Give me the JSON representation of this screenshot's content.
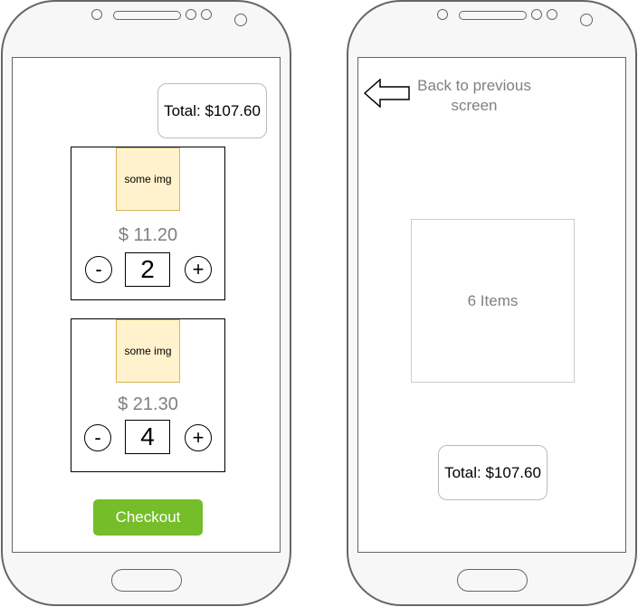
{
  "screen1": {
    "total_label": "Total: $107.60",
    "items": [
      {
        "image_label": "some img",
        "price": "$ 11.20",
        "quantity": "2"
      },
      {
        "image_label": "some img",
        "price": "$ 21.30",
        "quantity": "4"
      }
    ],
    "minus_label": "-",
    "plus_label": "+",
    "checkout_label": "Checkout"
  },
  "screen2": {
    "back_label": "Back to previous screen",
    "items_label": "6 Items",
    "total_label": "Total: $107.60"
  },
  "colors": {
    "checkout": "#75bd29",
    "image_placeholder_fill": "#fff2cc",
    "image_placeholder_border": "#d6b656",
    "muted_text": "#808080"
  }
}
